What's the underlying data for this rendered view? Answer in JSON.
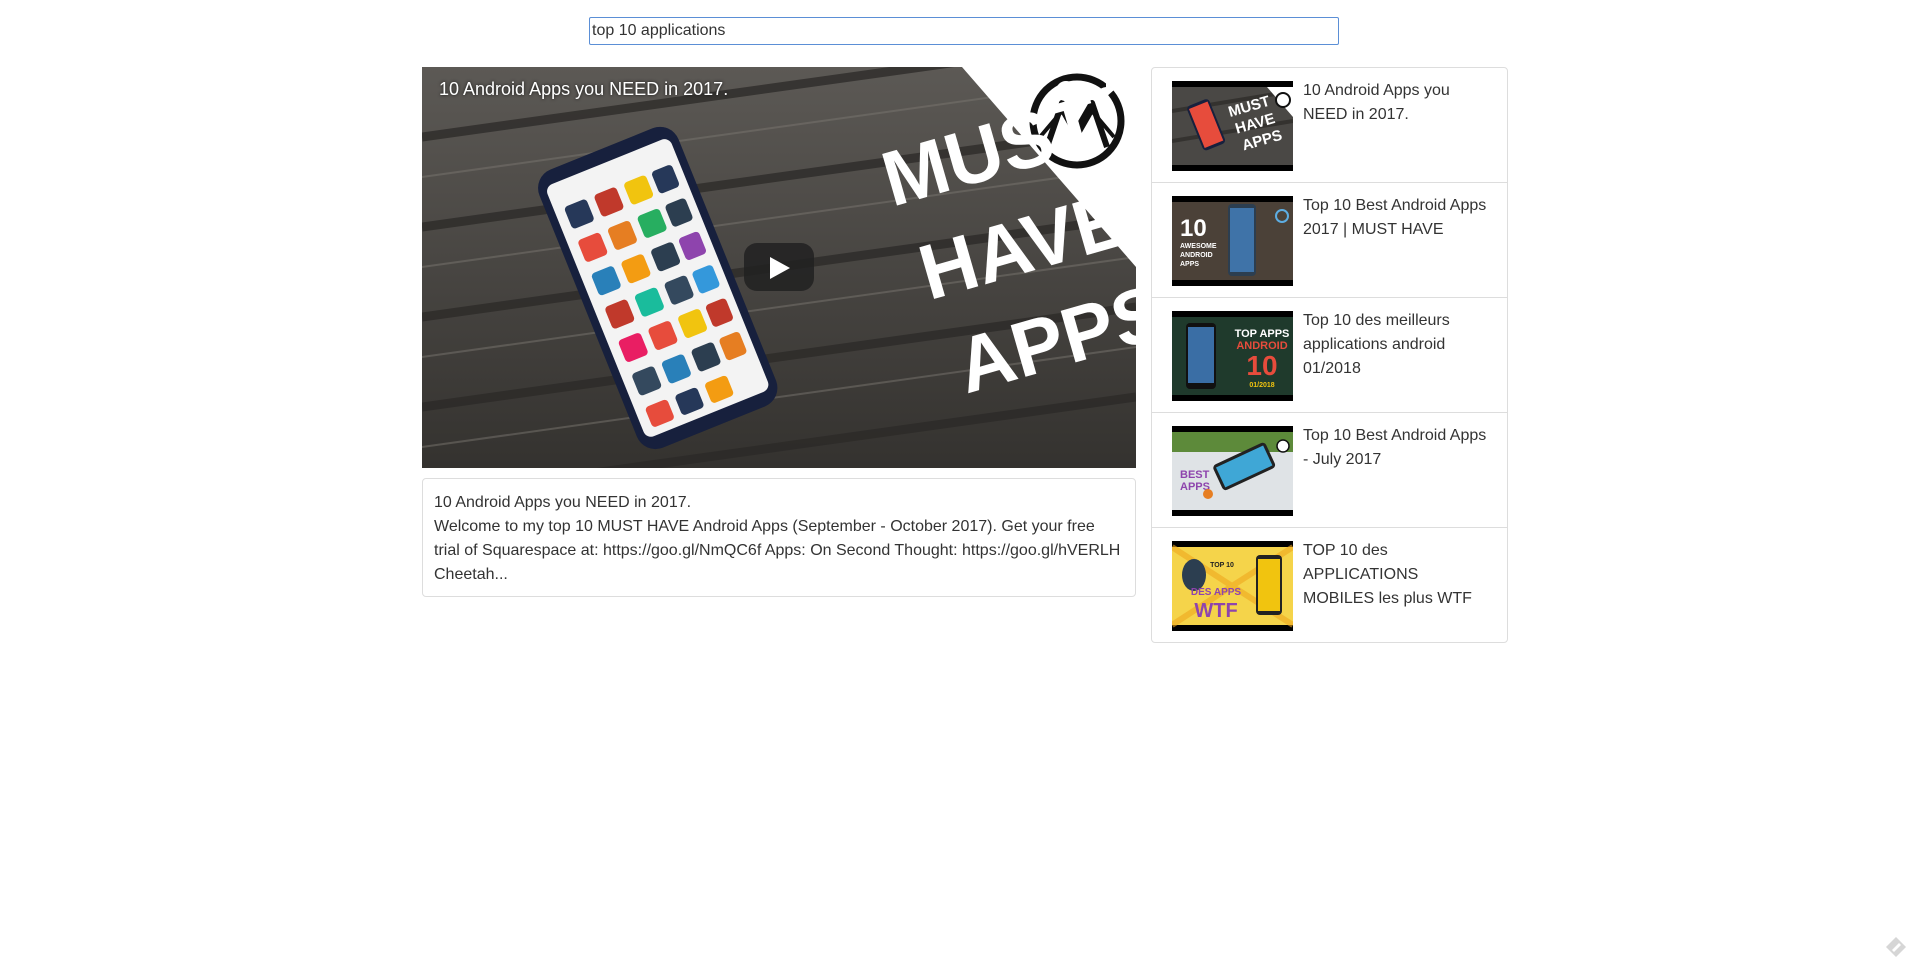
{
  "search": {
    "value": "top 10 applications"
  },
  "main_video": {
    "title": "10 Android Apps you NEED in 2017.",
    "thumbnail_text": [
      "MUST",
      "HAVE",
      "APPS"
    ],
    "description_title": "10 Android Apps you NEED in 2017.",
    "description": "Welcome to my top 10 MUST HAVE Android Apps (September - October 2017). Get your free trial of Squarespace at: https://goo.gl/NmQC6f Apps: On Second Thought: https://goo.gl/hVERLH Cheetah..."
  },
  "results": [
    {
      "title": "10 Android Apps you NEED in 2017.",
      "thumb_text": [
        "MUST",
        "HAVE",
        "APPS"
      ]
    },
    {
      "title": "Top 10 Best Android Apps 2017 | MUST HAVE",
      "thumb_text": [
        "10",
        "AWESOME",
        "ANDROID",
        "APPS"
      ]
    },
    {
      "title": "Top 10 des meilleurs applications android 01/2018",
      "thumb_text": [
        "TOP APPS",
        "ANDROID",
        "10",
        "01/2018"
      ]
    },
    {
      "title": "Top 10 Best Android Apps - July 2017",
      "thumb_text": [
        "BEST",
        "APPS"
      ]
    },
    {
      "title": "TOP 10 des APPLICATIONS MOBILES les plus WTF",
      "thumb_text": [
        "TOP 10",
        "DES APPS",
        "WTF"
      ]
    }
  ],
  "colors": {
    "search_border": "#5b8fd6",
    "panel_border": "#dddddd",
    "text": "#333333"
  }
}
